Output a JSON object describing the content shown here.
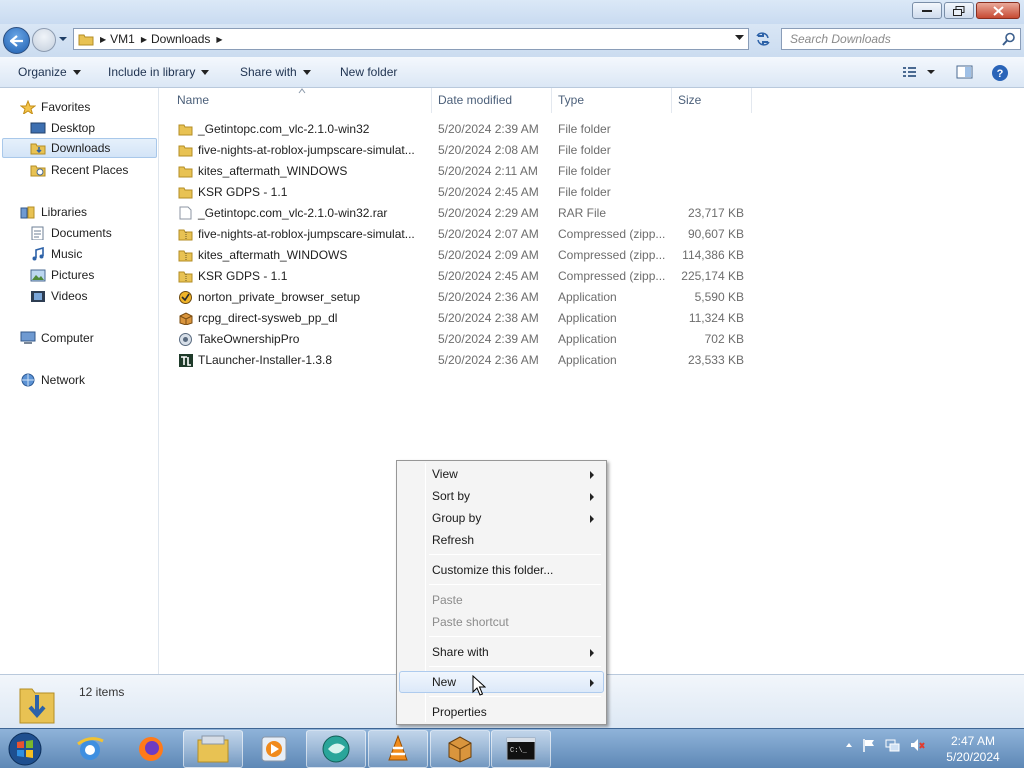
{
  "address": {
    "crumbs": [
      "VM1",
      "Downloads"
    ],
    "search_placeholder": "Search Downloads"
  },
  "commands": {
    "organize": "Organize",
    "include_in_library": "Include in library",
    "share_with": "Share with",
    "new_folder": "New folder"
  },
  "sidebar": {
    "favorites": "Favorites",
    "desktop": "Desktop",
    "downloads": "Downloads",
    "recent_places": "Recent Places",
    "libraries": "Libraries",
    "documents": "Documents",
    "music": "Music",
    "pictures": "Pictures",
    "videos": "Videos",
    "computer": "Computer",
    "network": "Network"
  },
  "columns": {
    "name": "Name",
    "date_modified": "Date modified",
    "type": "Type",
    "size": "Size"
  },
  "files": [
    {
      "name": "_Getintopc.com_vlc-2.1.0-win32",
      "date": "5/20/2024 2:39 AM",
      "type": "File folder",
      "size": "",
      "icon": "folder-icon"
    },
    {
      "name": "five-nights-at-roblox-jumpscare-simulat...",
      "date": "5/20/2024 2:08 AM",
      "type": "File folder",
      "size": "",
      "icon": "folder-icon"
    },
    {
      "name": "kites_aftermath_WINDOWS",
      "date": "5/20/2024 2:11 AM",
      "type": "File folder",
      "size": "",
      "icon": "folder-icon"
    },
    {
      "name": "KSR GDPS - 1.1",
      "date": "5/20/2024 2:45 AM",
      "type": "File folder",
      "size": "",
      "icon": "folder-icon"
    },
    {
      "name": "_Getintopc.com_vlc-2.1.0-win32.rar",
      "date": "5/20/2024 2:29 AM",
      "type": "RAR File",
      "size": "23,717 KB",
      "icon": "file-icon"
    },
    {
      "name": "five-nights-at-roblox-jumpscare-simulat...",
      "date": "5/20/2024 2:07 AM",
      "type": "Compressed (zipp...",
      "size": "90,607 KB",
      "icon": "zip-folder-icon"
    },
    {
      "name": "kites_aftermath_WINDOWS",
      "date": "5/20/2024 2:09 AM",
      "type": "Compressed (zipp...",
      "size": "114,386 KB",
      "icon": "zip-folder-icon"
    },
    {
      "name": "KSR GDPS - 1.1",
      "date": "5/20/2024 2:45 AM",
      "type": "Compressed (zipp...",
      "size": "225,174 KB",
      "icon": "zip-folder-icon"
    },
    {
      "name": "norton_private_browser_setup",
      "date": "5/20/2024 2:36 AM",
      "type": "Application",
      "size": "5,590 KB",
      "icon": "norton-icon"
    },
    {
      "name": "rcpg_direct-sysweb_pp_dl",
      "date": "5/20/2024 2:38 AM",
      "type": "Application",
      "size": "11,324 KB",
      "icon": "installer-box-icon"
    },
    {
      "name": "TakeOwnershipPro",
      "date": "5/20/2024 2:39 AM",
      "type": "Application",
      "size": "702 KB",
      "icon": "gear-app-icon"
    },
    {
      "name": "TLauncher-Installer-1.3.8",
      "date": "5/20/2024 2:36 AM",
      "type": "Application",
      "size": "23,533 KB",
      "icon": "tlauncher-icon"
    }
  ],
  "status": {
    "item_count": "12 items"
  },
  "context_menu": {
    "view": "View",
    "sort_by": "Sort by",
    "group_by": "Group by",
    "refresh": "Refresh",
    "customize": "Customize this folder...",
    "paste": "Paste",
    "paste_shortcut": "Paste shortcut",
    "share_with": "Share with",
    "new": "New",
    "properties": "Properties"
  },
  "taskbar": {
    "time": "2:47 AM",
    "date": "5/20/2024"
  }
}
